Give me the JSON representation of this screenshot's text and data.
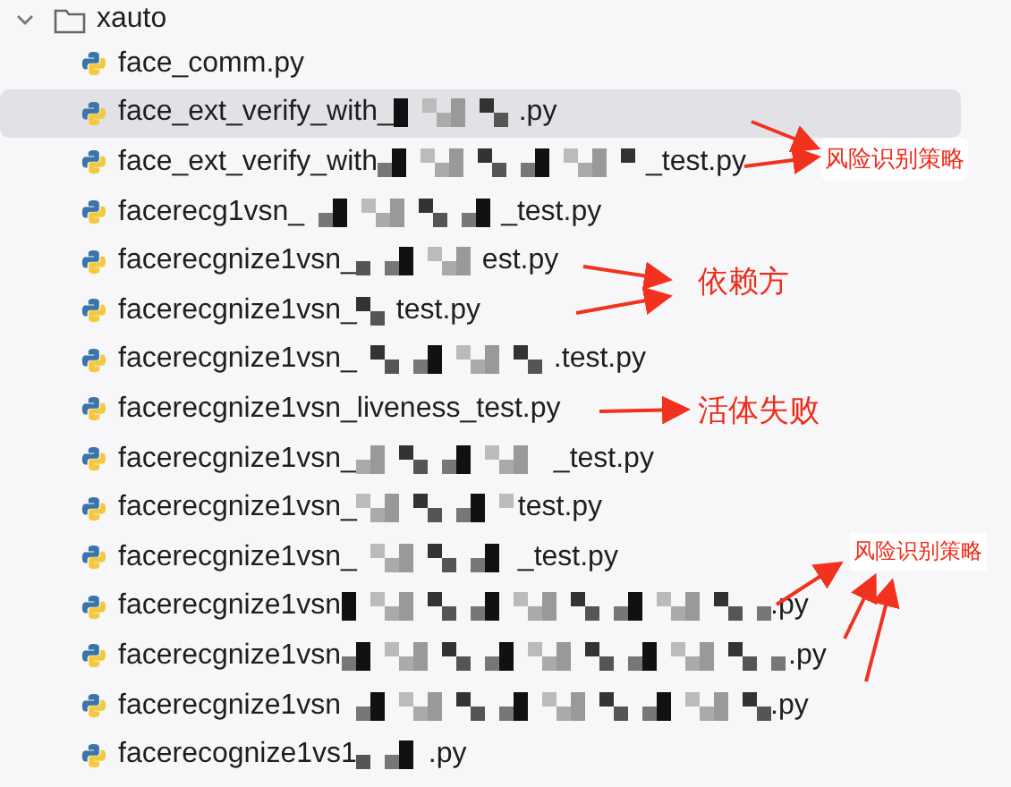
{
  "folder": {
    "name": "xauto",
    "expanded": true
  },
  "files": [
    {
      "prefix": "face_comm.py",
      "redacted": false,
      "selected": false
    },
    {
      "prefix": "face_ext_verify_with_",
      "redacted": true,
      "suffix": ".py",
      "selected": true
    },
    {
      "prefix": "face_ext_verify_with",
      "redacted": true,
      "suffix": "_test.py",
      "selected": false
    },
    {
      "prefix": "facerecg1vsn_",
      "redacted": true,
      "suffix": "_test.py",
      "selected": false
    },
    {
      "prefix": "facerecgnize1vsn_",
      "redacted": true,
      "suffix": "est.py",
      "selected": false
    },
    {
      "prefix": "facerecgnize1vsn_",
      "redacted": true,
      "suffix": "test.py",
      "selected": false
    },
    {
      "prefix": "facerecgnize1vsn_",
      "redacted": true,
      "suffix": ".test.py",
      "selected": false
    },
    {
      "prefix": "facerecgnize1vsn_liveness_test.py",
      "redacted": false,
      "selected": false
    },
    {
      "prefix": "facerecgnize1vsn_",
      "redacted": true,
      "suffix": "_test.py",
      "selected": false
    },
    {
      "prefix": "facerecgnize1vsn_",
      "redacted": true,
      "suffix": "test.py",
      "selected": false
    },
    {
      "prefix": "facerecgnize1vsn_",
      "redacted": true,
      "suffix": "_test.py",
      "selected": false
    },
    {
      "prefix": "facerecgnize1vsn",
      "redacted": true,
      "suffix": ".py",
      "selected": false
    },
    {
      "prefix": "facerecgnize1vsn",
      "redacted": true,
      "suffix": ".py",
      "selected": false
    },
    {
      "prefix": "facerecgnize1vsn",
      "redacted": true,
      "suffix": ".py",
      "selected": false
    },
    {
      "prefix": "facerecognize1vs1",
      "redacted": true,
      "suffix": ".py",
      "selected": false
    }
  ],
  "annotations": [
    {
      "text": "风险识别策略",
      "kind": "boxed"
    },
    {
      "text": "依赖方",
      "kind": "large"
    },
    {
      "text": "活体失败",
      "kind": "large"
    },
    {
      "text": "风险识别策略",
      "kind": "small"
    }
  ]
}
